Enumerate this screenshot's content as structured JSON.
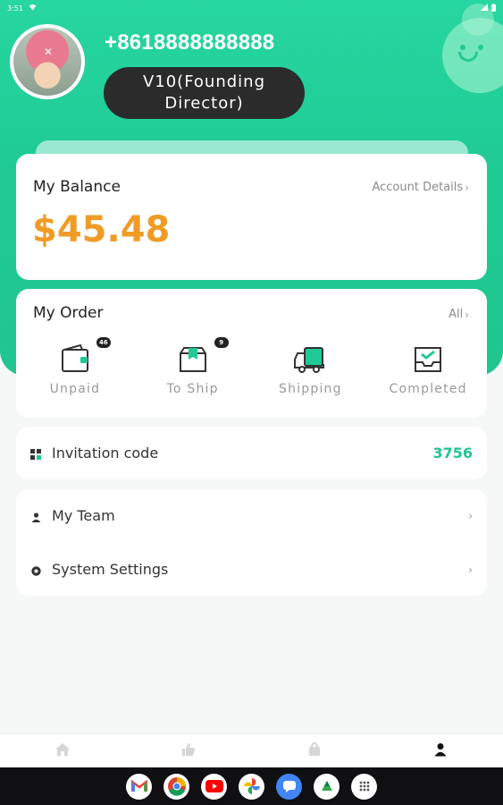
{
  "status_bar": {
    "time": "3:51"
  },
  "profile": {
    "phone": "+8618888888888",
    "level": "V10(Founding Director)"
  },
  "balance": {
    "title": "My Balance",
    "details_link": "Account Details",
    "amount": "$45.48"
  },
  "orders": {
    "title": "My Order",
    "all_link": "All",
    "items": [
      {
        "label": "Unpaid",
        "badge": "46",
        "icon": "wallet-icon"
      },
      {
        "label": "To Ship",
        "badge": "9",
        "icon": "box-icon"
      },
      {
        "label": "Shipping",
        "badge": "",
        "icon": "truck-icon"
      },
      {
        "label": "Completed",
        "badge": "",
        "icon": "inbox-check-icon"
      }
    ]
  },
  "invitation": {
    "label": "Invitation code",
    "code": "3756"
  },
  "menu": {
    "team_label": "My Team",
    "settings_label": "System Settings"
  },
  "bottom_nav": [
    "home-icon",
    "thumb-up-icon",
    "bag-icon",
    "user-icon"
  ],
  "colors": {
    "accent": "#20c995",
    "amount": "#ef9c26",
    "dark_pill": "#2b2b2b"
  },
  "system_apps": [
    "gmail-icon",
    "chrome-icon",
    "youtube-icon",
    "photos-icon",
    "messages-icon",
    "files-icon",
    "apps-icon"
  ]
}
